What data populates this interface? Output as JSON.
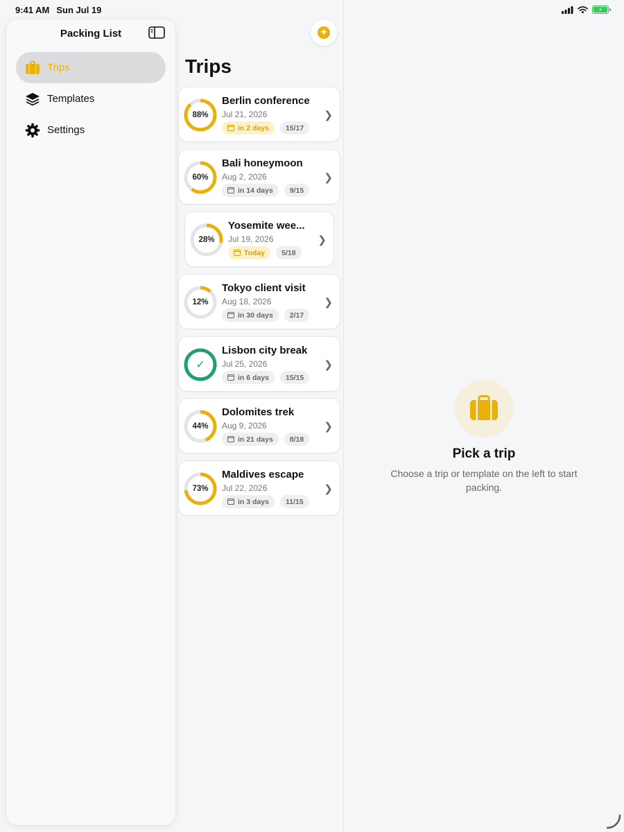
{
  "status_bar": {
    "time": "9:41 AM",
    "date": "Sun Jul 19"
  },
  "sidebar": {
    "title": "Packing List",
    "items": [
      {
        "label": "Trips",
        "icon": "suitcase-icon",
        "active": true
      },
      {
        "label": "Templates",
        "icon": "layers-icon",
        "active": false
      },
      {
        "label": "Settings",
        "icon": "gear-icon",
        "active": false
      }
    ]
  },
  "list": {
    "title": "Trips",
    "trips": [
      {
        "name": "Berlin conference",
        "date": "Jul 21, 2026",
        "percent": "88%",
        "progress": 0.88,
        "when": "in 2 days",
        "count": "15/17",
        "urgent": true
      },
      {
        "name": "Bali honeymoon",
        "date": "Aug 2, 2026",
        "percent": "60%",
        "progress": 0.6,
        "when": "in 14 days",
        "count": "9/15",
        "urgent": false
      },
      {
        "name": "Yosemite wee...",
        "date": "Jul 19, 2026",
        "percent": "28%",
        "progress": 0.28,
        "when": "Today",
        "count": "5/18",
        "urgent": true
      },
      {
        "name": "Tokyo client visit",
        "date": "Aug 18, 2026",
        "percent": "12%",
        "progress": 0.12,
        "when": "in 30 days",
        "count": "2/17",
        "urgent": false
      },
      {
        "name": "Lisbon city break",
        "date": "Jul 25, 2026",
        "percent": "",
        "progress": 1.0,
        "when": "in 6 days",
        "count": "15/15",
        "urgent": false
      },
      {
        "name": "Dolomites trek",
        "date": "Aug 9, 2026",
        "percent": "44%",
        "progress": 0.44,
        "when": "in 21 days",
        "count": "8/18",
        "urgent": false
      },
      {
        "name": "Maldives escape",
        "date": "Jul 22, 2026",
        "percent": "73%",
        "progress": 0.73,
        "when": "in 3 days",
        "count": "11/15",
        "urgent": false
      }
    ]
  },
  "detail": {
    "title": "Pick a trip",
    "subtitle": "Choose a trip or template on the left to start packing."
  },
  "colors": {
    "accent": "#e8b10c",
    "complete": "#22a06b",
    "track": "#e3e4e7"
  }
}
